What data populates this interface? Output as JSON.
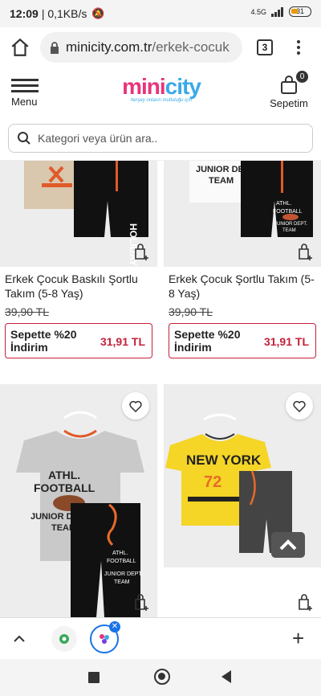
{
  "status_bar": {
    "time": "12:09",
    "net_speed": "| 0,1KB/s",
    "signal": "4.5G",
    "battery": "31"
  },
  "browser": {
    "url_domain": "minicity.com.tr",
    "url_path": "/erkek-cocuk",
    "tab_count": "3"
  },
  "header": {
    "menu_label": "Menu",
    "logo_text": "minicity",
    "logo_tagline": "herşey onların mutluluğu için",
    "cart_label": "Sepetim",
    "cart_count": "0"
  },
  "search": {
    "placeholder": "Kategori veya ürün ara.."
  },
  "products": [
    {
      "title": "Erkek Çocuk Baskılı Şortlu Takım (5-8 Yaş)",
      "old_price": "39,90 TL",
      "promo_text": "Sepette %20 İndirim",
      "promo_price": "31,91 TL",
      "print_text": "HOLIDAY"
    },
    {
      "title": "Erkek Çocuk Şortlu Takım (5-8 Yaş)",
      "old_price": "39,90 TL",
      "promo_text": "Sepette %20 İndirim",
      "promo_price": "31,91 TL",
      "print_text": "JUNIOR DEPT. TEAM"
    },
    {
      "shirt_text": "ATHL. FOOTBALL JUNIOR DEPT. TEAM",
      "shorts_text": "ATHL. FOOTBALL JUNIOR DEPT. TEAM"
    },
    {
      "shirt_text": "NEW YORK"
    }
  ],
  "colors": {
    "accent": "#c4213a",
    "brand_pink": "#e8347a",
    "brand_blue": "#3aa9e8",
    "tab_blue": "#1a73e8"
  }
}
